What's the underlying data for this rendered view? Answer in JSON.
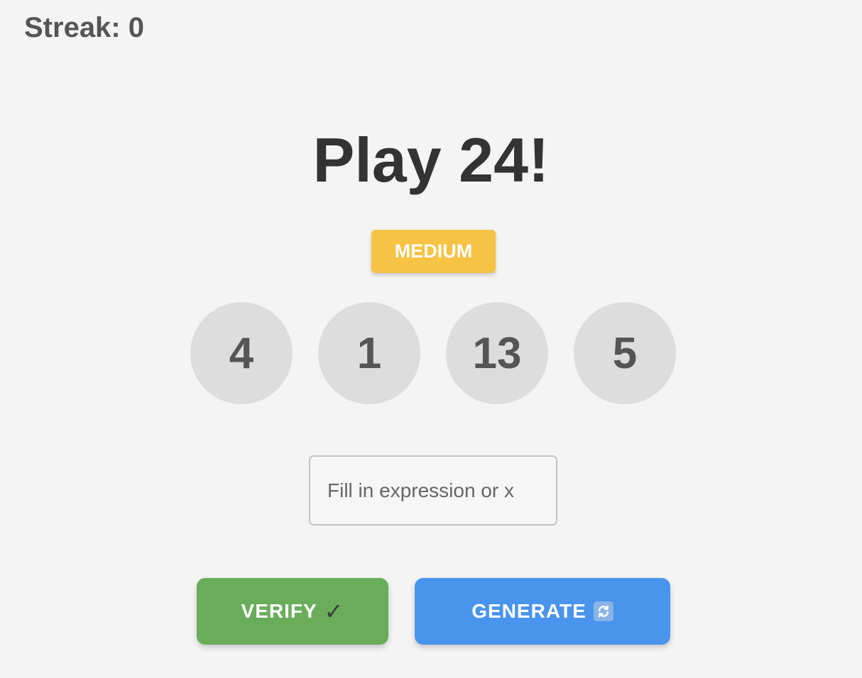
{
  "streak": {
    "label": "Streak: 0"
  },
  "title": "Play 24!",
  "difficulty": "MEDIUM",
  "numbers": [
    "4",
    "1",
    "13",
    "5"
  ],
  "expression_input": {
    "value": "",
    "placeholder": "Fill in expression or x"
  },
  "buttons": {
    "verify_label": "VERIFY",
    "verify_icon": "check-mark-icon",
    "generate_label": "GENERATE",
    "generate_icon": "refresh-icon"
  },
  "colors": {
    "background": "#f4f4f4",
    "difficulty_badge": "#f6c344",
    "number_circle": "#dddddd",
    "verify_button": "#69ad5b",
    "generate_button": "#4994ec"
  }
}
